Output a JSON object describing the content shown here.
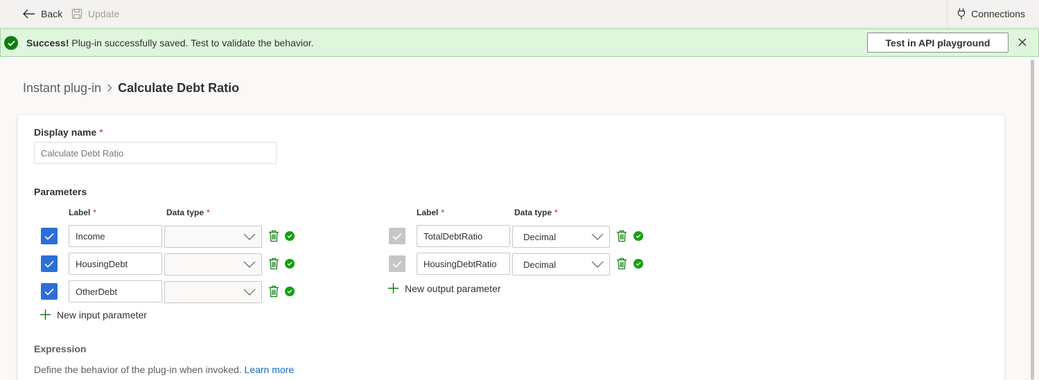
{
  "toolbar": {
    "back_label": "Back",
    "update_label": "Update",
    "connections_label": "Connections"
  },
  "banner": {
    "title": "Success!",
    "message": "Plug-in successfully saved. Test to validate the behavior.",
    "test_button": "Test in API playground"
  },
  "breadcrumb": {
    "parent": "Instant plug-in",
    "current": "Calculate Debt Ratio"
  },
  "form": {
    "display_name_label": "Display name",
    "display_name_placeholder": "Calculate Debt Ratio",
    "parameters_label": "Parameters",
    "label_header": "Label",
    "data_type_header": "Data type",
    "input_params": [
      {
        "label": "Income",
        "data_type": ""
      },
      {
        "label": "HousingDebt",
        "data_type": ""
      },
      {
        "label": "OtherDebt",
        "data_type": ""
      }
    ],
    "output_params": [
      {
        "label": "TotalDebtRatio",
        "data_type": "Decimal"
      },
      {
        "label": "HousingDebtRatio",
        "data_type": "Decimal"
      }
    ],
    "new_input": "New input parameter",
    "new_output": "New output parameter",
    "expression_label": "Expression",
    "expression_desc": "Define the behavior of the plug-in when invoked.",
    "learn_more": "Learn more"
  },
  "colors": {
    "accent": "#2b6fd6",
    "success": "#107c10",
    "banner_bg": "#dff6dd",
    "link": "#0f6cbd"
  }
}
